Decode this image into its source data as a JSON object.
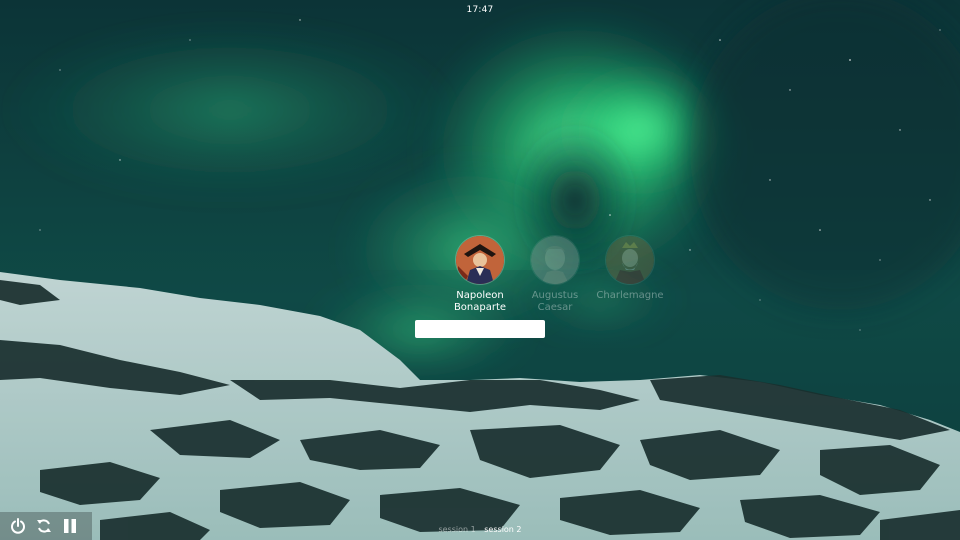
{
  "clock": {
    "time": "17:47"
  },
  "users": [
    {
      "name_line1": "Napoleon",
      "name_line2": "Bonaparte",
      "selected": true
    },
    {
      "name_line1": "Augustus",
      "name_line2": "Caesar",
      "selected": false
    },
    {
      "name_line1": "Charlemagne",
      "name_line2": "",
      "selected": false
    }
  ],
  "password": {
    "value": "",
    "placeholder": ""
  },
  "sessions": [
    {
      "label": "session 1",
      "selected": false
    },
    {
      "label": "session 2",
      "selected": true
    }
  ],
  "power_icons": [
    "power-icon",
    "restart-icon",
    "suspend-icon"
  ],
  "colors": {
    "aurora": "#36f28f",
    "sky": "#0a2d30",
    "snow": "#d9ece9"
  }
}
